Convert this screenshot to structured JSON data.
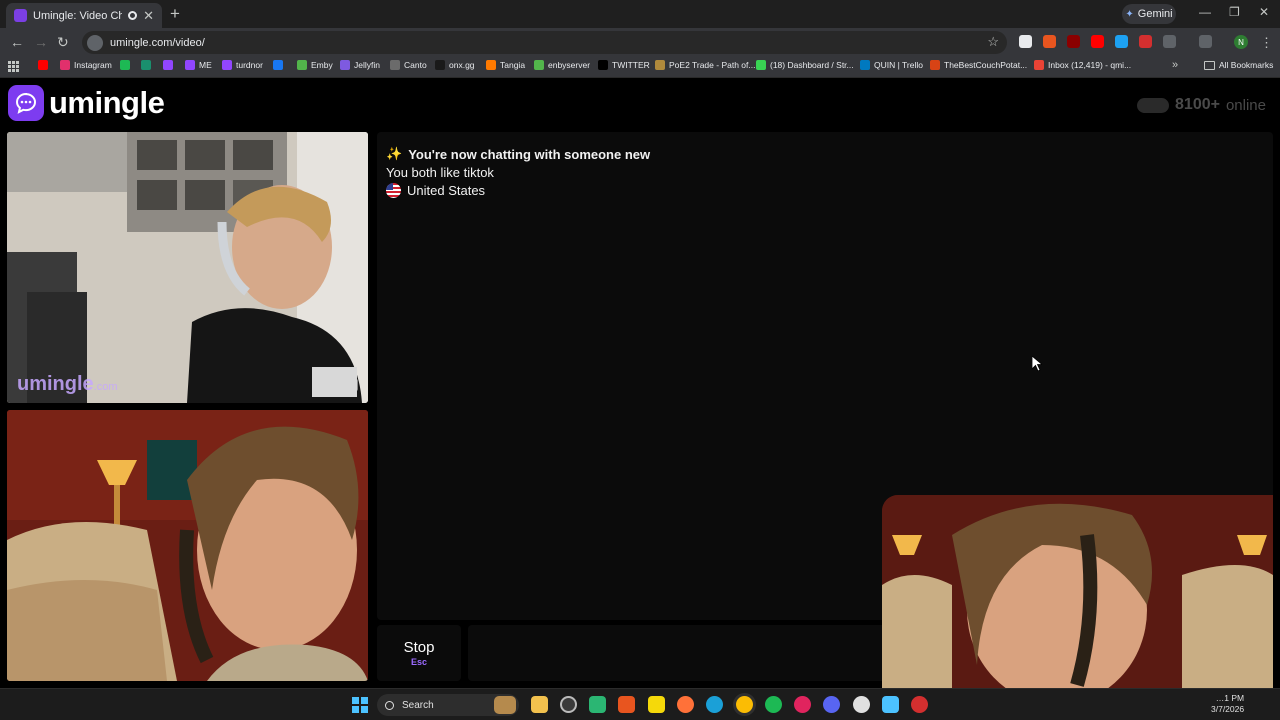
{
  "browser": {
    "tab_title": "Umingle: Video Chat with S",
    "tab_close": "✕",
    "new_tab": "+",
    "gemini_label": "Gemini",
    "url": "umingle.com/video/",
    "profile_initial": "N",
    "window_controls": {
      "minimize": "—",
      "maximize": "❐",
      "close": "✕"
    },
    "bookmarks": [
      {
        "label": "",
        "icon_color": "#ff0000"
      },
      {
        "label": "Instagram",
        "icon_color": "#e1306c"
      },
      {
        "label": "",
        "icon_color": "#1db954"
      },
      {
        "label": "",
        "icon_color": "#1a8f6e"
      },
      {
        "label": "",
        "icon_color": "#9146ff"
      },
      {
        "label": "ME",
        "icon_color": "#9146ff"
      },
      {
        "label": "turdnor",
        "icon_color": "#9146ff"
      },
      {
        "label": "",
        "icon_color": "#1877f2"
      },
      {
        "label": "Emby",
        "icon_color": "#52b54b"
      },
      {
        "label": "Jellyfin",
        "icon_color": "#7e5ae0"
      },
      {
        "label": "Canto",
        "icon_color": "#6b6b6b"
      },
      {
        "label": "onx.gg",
        "icon_color": "#1a1a1a"
      },
      {
        "label": "Tangia",
        "icon_color": "#ff7a00"
      },
      {
        "label": "enbyserver",
        "icon_color": "#52b54b"
      },
      {
        "label": "TWITTER",
        "icon_color": "#000000"
      },
      {
        "label": "PoE2 Trade - Path of...",
        "icon_color": "#b08a3c"
      },
      {
        "label": "(18) Dashboard / Str...",
        "icon_color": "#39d353"
      },
      {
        "label": "QUIN | Trello",
        "icon_color": "#0079bf"
      },
      {
        "label": "TheBestCouchPotat...",
        "icon_color": "#d84315"
      },
      {
        "label": "Inbox (12,419) - qmi...",
        "icon_color": "#ea4335"
      }
    ],
    "more_bookmarks": "»",
    "all_bookmarks": "All Bookmarks"
  },
  "site": {
    "brand_name": "umingle",
    "online_count": "8100+",
    "online_word": "online",
    "watermark_main": "umingle",
    "watermark_suffix": ".com",
    "accent_color": "#7d3cf0"
  },
  "chat": {
    "messages": [
      {
        "icon": "✨",
        "text": "You're now chatting with someone new"
      },
      {
        "icon": "",
        "text": "You both like tiktok"
      },
      {
        "icon": "us-flag",
        "text": "United States"
      }
    ]
  },
  "controls": {
    "stop_label": "Stop",
    "stop_key": "Esc",
    "message_placeholder": ""
  },
  "taskbar": {
    "search_label": "Search",
    "time": "…1 PM",
    "date": "3/7/2026"
  }
}
